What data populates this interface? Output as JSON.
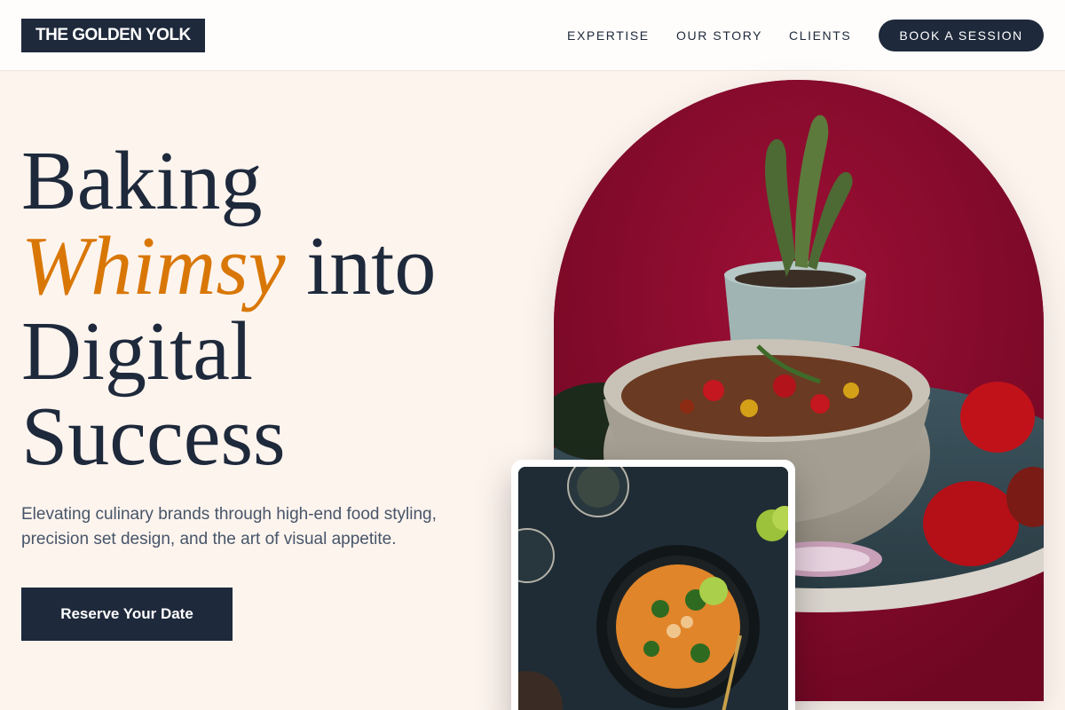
{
  "header": {
    "logo": "THE GOLDEN YOLK",
    "nav": [
      "EXPERTISE",
      "OUR STORY",
      "CLIENTS"
    ],
    "cta": "BOOK A SESSION"
  },
  "hero": {
    "line1": "Baking",
    "accent": "Whimsy",
    "line2_rest": "into",
    "line3": "Digital",
    "line4": "Success",
    "subtext": "Elevating culinary brands through high-end food styling, precision set design, and the art of visual appetite.",
    "button": "Reserve Your Date"
  },
  "colors": {
    "ink": "#1e293b",
    "accent": "#d97706",
    "background": "#fdf4ee",
    "photo_backdrop": "#8b0a2c"
  },
  "images": {
    "arch_photo": "bowl-of-stew-with-peppers-and-cactus",
    "card_photo": "curry-in-cast-iron-pan-overhead"
  }
}
